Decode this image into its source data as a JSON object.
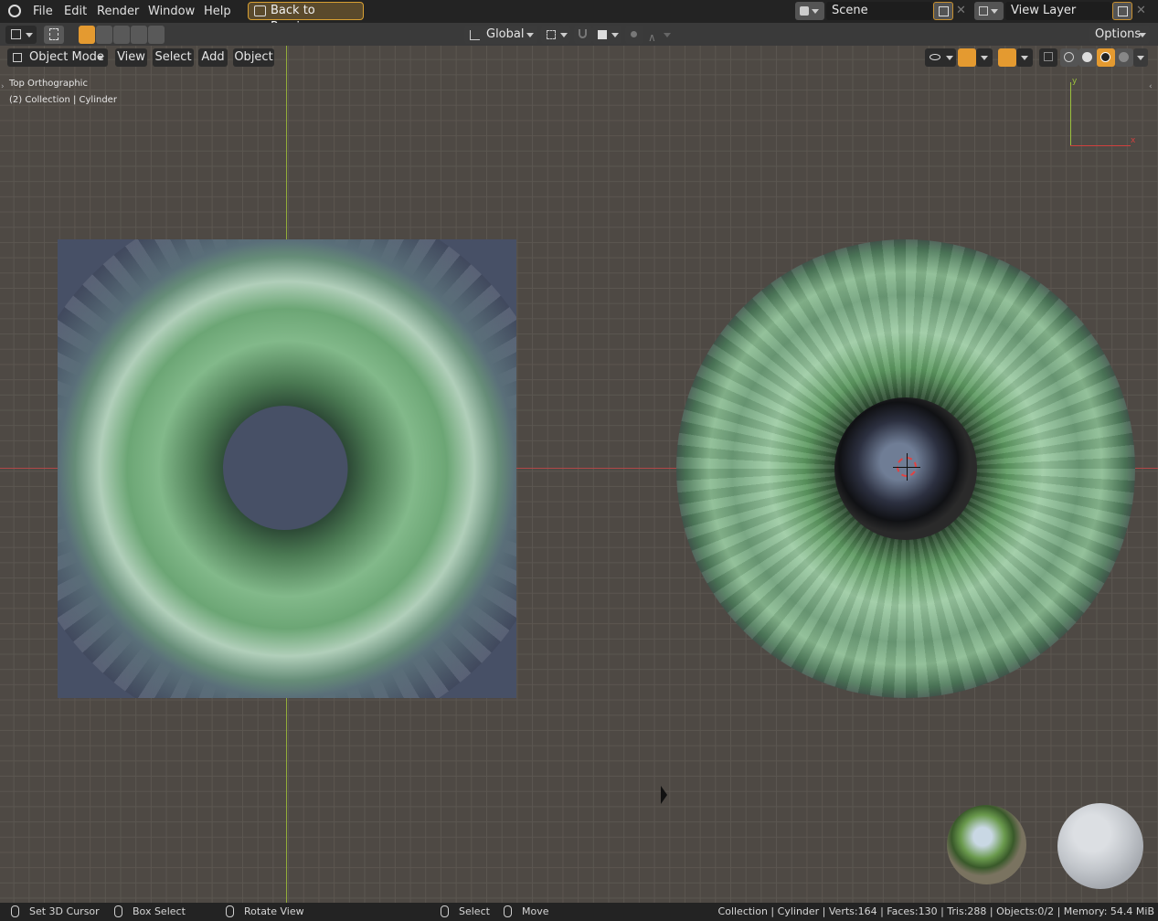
{
  "topbar": {
    "menus": [
      "File",
      "Edit",
      "Render",
      "Window",
      "Help"
    ],
    "back_button": "Back to Previous",
    "scene_field": "Scene",
    "view_layer_field": "View Layer"
  },
  "toolbar": {
    "transform_orientation": "Global",
    "options_label": "Options"
  },
  "viewport_header": {
    "mode": "Object Mode",
    "menus": [
      "View",
      "Select",
      "Add",
      "Object"
    ]
  },
  "viewport": {
    "view_name": "Top Orthographic",
    "collection_info": "(2) Collection | Cylinder",
    "gizmo_y": "y",
    "gizmo_x": "x"
  },
  "statusbar": {
    "set_cursor": "Set 3D Cursor",
    "box_select": "Box Select",
    "rotate_view": "Rotate View",
    "select": "Select",
    "move": "Move",
    "stats": "Collection | Cylinder | Verts:164 | Faces:130 | Tris:288 | Objects:0/2 | Memory: 54.4 MiB"
  },
  "colors": {
    "accent": "#e49a30",
    "x_axis": "#b04848",
    "y_axis": "#93ad3a"
  }
}
